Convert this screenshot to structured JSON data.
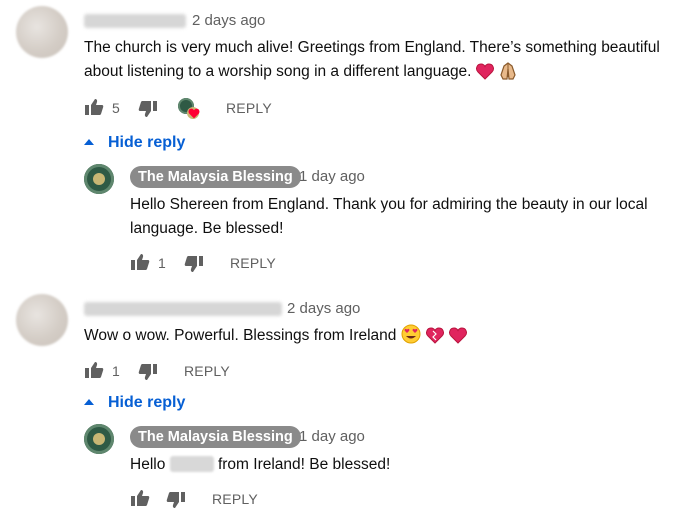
{
  "comments": [
    {
      "time": "2 days ago",
      "text": "The church is very much alive! Greetings from England. There’s something beautiful about listening to a worship song in a different language.",
      "likes": "5",
      "reply_label": "REPLY",
      "hide_reply_label": "Hide reply",
      "reply": {
        "channel": "The Malaysia Blessing",
        "time": "1 day ago",
        "text": "Hello Shereen from England. Thank you for admiring the beauty in our local language. Be blessed!",
        "likes": "1",
        "reply_label": "REPLY"
      }
    },
    {
      "time": "2 days ago",
      "text": "Wow o wow. Powerful. Blessings from Ireland",
      "likes": "1",
      "reply_label": "REPLY",
      "hide_reply_label": "Hide reply",
      "reply": {
        "channel": "The Malaysia Blessing",
        "time": "1 day ago",
        "text_before": "Hello",
        "text_after": "from Ireland! Be blessed!",
        "reply_label": "REPLY"
      }
    }
  ],
  "colors": {
    "link_blue": "#065fd4",
    "meta_gray": "#606060",
    "heart_red": "#e0245e",
    "chip_gray": "#8a8a8a"
  },
  "icons": [
    "thumb-up-icon",
    "thumb-down-icon",
    "creator-heart-icon",
    "heart-emoji",
    "folded-hands-emoji",
    "heart-eyes-emoji"
  ]
}
